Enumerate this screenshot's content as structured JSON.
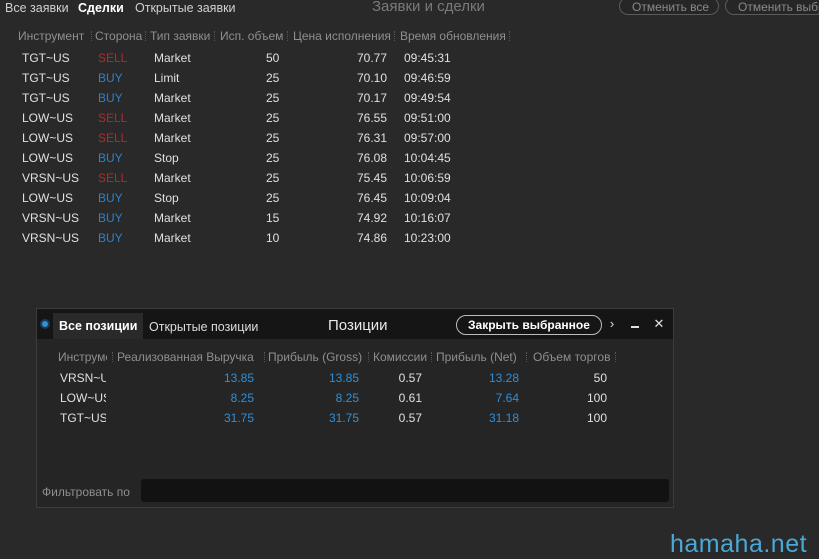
{
  "top_tabs": {
    "all_orders": "Все заявки",
    "trades": "Сделки",
    "open_orders": "Открытые заявки"
  },
  "window_title": "Заявки и сделки",
  "top_buttons": {
    "cancel_all": "Отменить все",
    "cancel_selected": "Отменить выбранное"
  },
  "orders": {
    "columns": [
      "Инструмент",
      "Сторона",
      "Тип заявки",
      "Исп. объем",
      "Цена исполнения",
      "Время обновления"
    ],
    "rows": [
      {
        "instrument": "TGT~US",
        "side": "SELL",
        "type": "Market",
        "qty": "50",
        "price": "70.77",
        "time": "09:45:31"
      },
      {
        "instrument": "TGT~US",
        "side": "BUY",
        "type": "Limit",
        "qty": "25",
        "price": "70.10",
        "time": "09:46:59"
      },
      {
        "instrument": "TGT~US",
        "side": "BUY",
        "type": "Market",
        "qty": "25",
        "price": "70.17",
        "time": "09:49:54"
      },
      {
        "instrument": "LOW~US",
        "side": "SELL",
        "type": "Market",
        "qty": "25",
        "price": "76.55",
        "time": "09:51:00"
      },
      {
        "instrument": "LOW~US",
        "side": "SELL",
        "type": "Market",
        "qty": "25",
        "price": "76.31",
        "time": "09:57:00"
      },
      {
        "instrument": "LOW~US",
        "side": "BUY",
        "type": "Stop",
        "qty": "25",
        "price": "76.08",
        "time": "10:04:45"
      },
      {
        "instrument": "VRSN~US",
        "side": "SELL",
        "type": "Market",
        "qty": "25",
        "price": "75.45",
        "time": "10:06:59"
      },
      {
        "instrument": "LOW~US",
        "side": "BUY",
        "type": "Stop",
        "qty": "25",
        "price": "76.45",
        "time": "10:09:04"
      },
      {
        "instrument": "VRSN~US",
        "side": "BUY",
        "type": "Market",
        "qty": "15",
        "price": "74.92",
        "time": "10:16:07"
      },
      {
        "instrument": "VRSN~US",
        "side": "BUY",
        "type": "Market",
        "qty": "10",
        "price": "74.86",
        "time": "10:23:00"
      }
    ]
  },
  "positions": {
    "tabs": {
      "all": "Все позиции",
      "open": "Открытые позиции"
    },
    "title": "Позиции",
    "close_selected": "Закрыть выбранное",
    "columns": [
      "Инструмент",
      "Реализованная Выручка",
      "Прибыль (Gross)",
      "Комиссии",
      "Прибыль (Net)",
      "Объем торгов"
    ],
    "rows": [
      {
        "instrument": "VRSN~US",
        "revenue": "13.85",
        "gross": "13.85",
        "commission": "0.57",
        "net": "13.28",
        "volume": "50"
      },
      {
        "instrument": "LOW~US",
        "revenue": "8.25",
        "gross": "8.25",
        "commission": "0.61",
        "net": "7.64",
        "volume": "100"
      },
      {
        "instrument": "TGT~US",
        "revenue": "31.75",
        "gross": "31.75",
        "commission": "0.57",
        "net": "31.18",
        "volume": "100"
      }
    ],
    "filter_label": "Фильтровать по",
    "filter_value": ""
  },
  "watermark": "hamaha.net",
  "colors": {
    "sell": "#b02a2a",
    "buy": "#2f7fc8",
    "accent_blue": "#2f8fd8"
  }
}
